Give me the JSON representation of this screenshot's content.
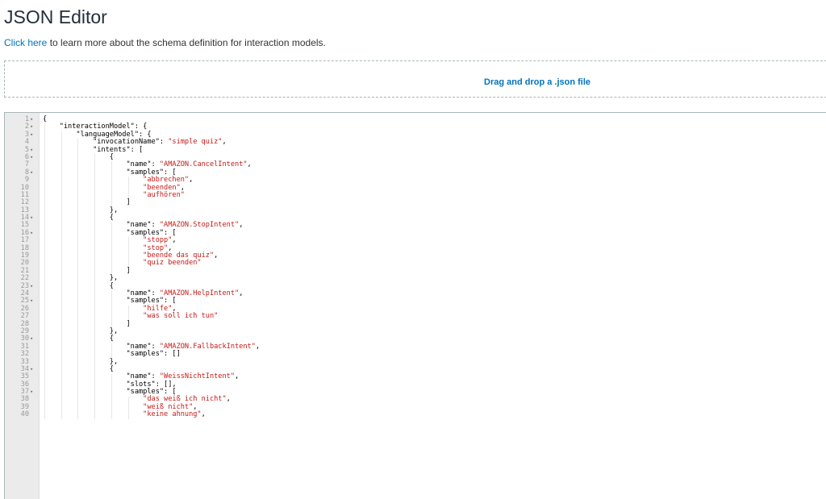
{
  "header": {
    "title": "JSON Editor",
    "link_text": "Click here",
    "subtitle_rest": " to learn more about the schema definition for interaction models."
  },
  "dropzone": {
    "label": "Drag and drop a .json file"
  },
  "editor": {
    "lines": [
      {
        "n": "1",
        "fold": true,
        "parts": [
          [
            "p",
            "{"
          ]
        ]
      },
      {
        "n": "2",
        "fold": true,
        "parts": [
          [
            "p",
            "    \"interactionModel\": {"
          ]
        ]
      },
      {
        "n": "3",
        "fold": true,
        "parts": [
          [
            "p",
            "        \"languageModel\": {"
          ]
        ]
      },
      {
        "n": "4",
        "fold": false,
        "parts": [
          [
            "p",
            "            \"invocationName\": "
          ],
          [
            "s",
            "\"simple quiz\""
          ],
          [
            "p",
            ","
          ]
        ]
      },
      {
        "n": "5",
        "fold": true,
        "parts": [
          [
            "p",
            "            \"intents\": ["
          ]
        ]
      },
      {
        "n": "6",
        "fold": true,
        "parts": [
          [
            "p",
            "                {"
          ]
        ]
      },
      {
        "n": "7",
        "fold": false,
        "parts": [
          [
            "p",
            "                    \"name\": "
          ],
          [
            "s",
            "\"AMAZON.CancelIntent\""
          ],
          [
            "p",
            ","
          ]
        ]
      },
      {
        "n": "8",
        "fold": true,
        "parts": [
          [
            "p",
            "                    \"samples\": ["
          ]
        ]
      },
      {
        "n": "9",
        "fold": false,
        "parts": [
          [
            "s",
            "                        \"abbrechen\""
          ],
          [
            "p",
            ","
          ]
        ]
      },
      {
        "n": "10",
        "fold": false,
        "parts": [
          [
            "s",
            "                        \"beenden\""
          ],
          [
            "p",
            ","
          ]
        ]
      },
      {
        "n": "11",
        "fold": false,
        "parts": [
          [
            "s",
            "                        \"aufhören\""
          ]
        ]
      },
      {
        "n": "12",
        "fold": false,
        "parts": [
          [
            "p",
            "                    ]"
          ]
        ]
      },
      {
        "n": "13",
        "fold": false,
        "parts": [
          [
            "p",
            "                },"
          ]
        ]
      },
      {
        "n": "14",
        "fold": true,
        "parts": [
          [
            "p",
            "                {"
          ]
        ]
      },
      {
        "n": "15",
        "fold": false,
        "parts": [
          [
            "p",
            "                    \"name\": "
          ],
          [
            "s",
            "\"AMAZON.StopIntent\""
          ],
          [
            "p",
            ","
          ]
        ]
      },
      {
        "n": "16",
        "fold": true,
        "parts": [
          [
            "p",
            "                    \"samples\": ["
          ]
        ]
      },
      {
        "n": "17",
        "fold": false,
        "parts": [
          [
            "s",
            "                        \"stopp\""
          ],
          [
            "p",
            ","
          ]
        ]
      },
      {
        "n": "18",
        "fold": false,
        "parts": [
          [
            "s",
            "                        \"stop\""
          ],
          [
            "p",
            ","
          ]
        ]
      },
      {
        "n": "19",
        "fold": false,
        "parts": [
          [
            "s",
            "                        \"beende das quiz\""
          ],
          [
            "p",
            ","
          ]
        ]
      },
      {
        "n": "20",
        "fold": false,
        "parts": [
          [
            "s",
            "                        \"quiz beenden\""
          ]
        ]
      },
      {
        "n": "21",
        "fold": false,
        "parts": [
          [
            "p",
            "                    ]"
          ]
        ]
      },
      {
        "n": "22",
        "fold": false,
        "parts": [
          [
            "p",
            "                },"
          ]
        ]
      },
      {
        "n": "23",
        "fold": true,
        "parts": [
          [
            "p",
            "                {"
          ]
        ]
      },
      {
        "n": "24",
        "fold": false,
        "parts": [
          [
            "p",
            "                    \"name\": "
          ],
          [
            "s",
            "\"AMAZON.HelpIntent\""
          ],
          [
            "p",
            ","
          ]
        ]
      },
      {
        "n": "25",
        "fold": true,
        "parts": [
          [
            "p",
            "                    \"samples\": ["
          ]
        ]
      },
      {
        "n": "26",
        "fold": false,
        "parts": [
          [
            "s",
            "                        \"hilfe\""
          ],
          [
            "p",
            ","
          ]
        ]
      },
      {
        "n": "27",
        "fold": false,
        "parts": [
          [
            "s",
            "                        \"was soll ich tun\""
          ]
        ]
      },
      {
        "n": "28",
        "fold": false,
        "parts": [
          [
            "p",
            "                    ]"
          ]
        ]
      },
      {
        "n": "29",
        "fold": false,
        "parts": [
          [
            "p",
            "                },"
          ]
        ]
      },
      {
        "n": "30",
        "fold": true,
        "parts": [
          [
            "p",
            "                {"
          ]
        ]
      },
      {
        "n": "31",
        "fold": false,
        "parts": [
          [
            "p",
            "                    \"name\": "
          ],
          [
            "s",
            "\"AMAZON.FallbackIntent\""
          ],
          [
            "p",
            ","
          ]
        ]
      },
      {
        "n": "32",
        "fold": false,
        "parts": [
          [
            "p",
            "                    \"samples\": []"
          ]
        ]
      },
      {
        "n": "33",
        "fold": false,
        "parts": [
          [
            "p",
            "                },"
          ]
        ]
      },
      {
        "n": "34",
        "fold": true,
        "parts": [
          [
            "p",
            "                {"
          ]
        ]
      },
      {
        "n": "35",
        "fold": false,
        "parts": [
          [
            "p",
            "                    \"name\": "
          ],
          [
            "s",
            "\"WeissNichtIntent\""
          ],
          [
            "p",
            ","
          ]
        ]
      },
      {
        "n": "36",
        "fold": false,
        "parts": [
          [
            "p",
            "                    \"slots\": [],"
          ]
        ]
      },
      {
        "n": "37",
        "fold": true,
        "parts": [
          [
            "p",
            "                    \"samples\": ["
          ]
        ]
      },
      {
        "n": "38",
        "fold": false,
        "parts": [
          [
            "s",
            "                        \"das weiß ich nicht\""
          ],
          [
            "p",
            ","
          ]
        ]
      },
      {
        "n": "39",
        "fold": false,
        "parts": [
          [
            "s",
            "                        \"weiß nicht\""
          ],
          [
            "p",
            ","
          ]
        ]
      },
      {
        "n": "40",
        "fold": false,
        "parts": [
          [
            "s",
            "                        \"keine ahnung\""
          ],
          [
            "p",
            ","
          ]
        ]
      }
    ]
  }
}
